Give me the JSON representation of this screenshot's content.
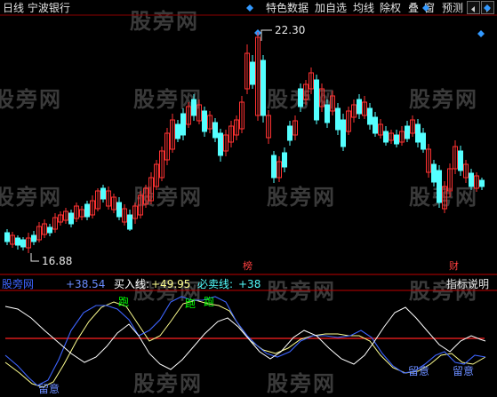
{
  "header": {
    "title": "日线  宁波银行",
    "menu": [
      "特色数据",
      "加自选",
      "均线",
      "除权",
      "叠",
      "窗",
      "预测"
    ]
  },
  "watermark": "股旁网",
  "price_chart": {
    "high_label": "22.30",
    "low_label": "16.88",
    "marker_top": "榜",
    "marker_bottom": "财"
  },
  "indicator": {
    "name_label": "股旁网",
    "value_1": "+38.54",
    "buy_label": "买入线:",
    "buy_value": "+49.95",
    "sell_label": "必卖线:",
    "sell_value": "+38",
    "help_button": "指标说明",
    "signal_run": "跑",
    "signal_stay": "留意"
  },
  "colors": {
    "background": "#000000",
    "up_candle": "#ff3232",
    "down_candle": "#54ffff",
    "white_line": "#ffffff",
    "blue_line": "#3d64ff",
    "yellow_line": "#ffff90",
    "red_line": "#ff2020",
    "signal_green": "#00ff00"
  }
}
